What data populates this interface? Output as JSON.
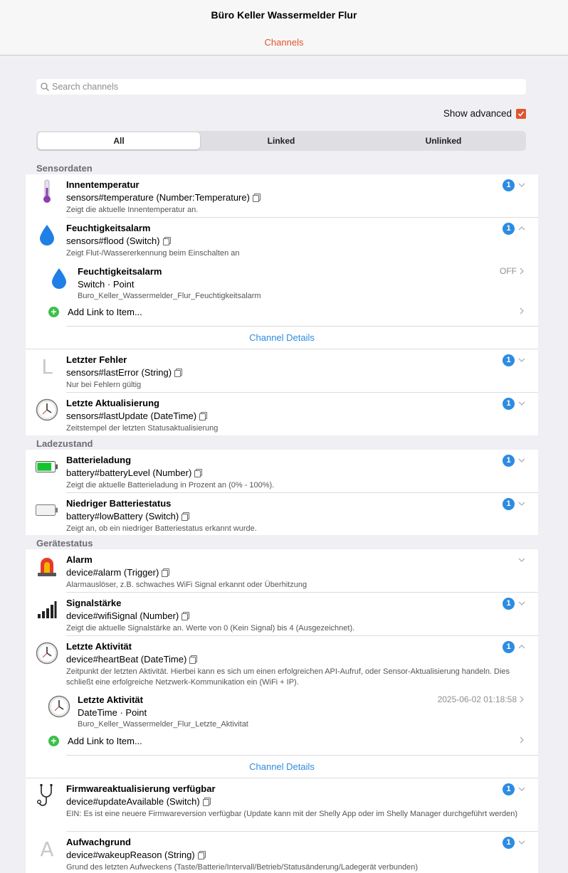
{
  "header": {
    "title": "Büro Keller Wassermelder Flur",
    "tab": "Channels"
  },
  "search": {
    "placeholder": "Search channels"
  },
  "advanced": {
    "label": "Show advanced",
    "checked": true
  },
  "filter": {
    "all": "All",
    "linked": "Linked",
    "unlinked": "Unlinked"
  },
  "groups": {
    "sensor": "Sensordaten",
    "battery": "Ladezustand",
    "device": "Gerätestatus"
  },
  "channels": {
    "temp": {
      "name": "Innentemperatur",
      "uid": "sensors#temperature (Number:Temperature)",
      "desc": "Zeigt die aktuelle Innentemperatur an.",
      "links": "1",
      "icon": "thermometer-icon"
    },
    "flood": {
      "name": "Feuchtigkeitsalarm",
      "uid": "sensors#flood (Switch)",
      "desc": "Zeigt Flut-/Wassererkennung beim Einschalten an",
      "links": "1",
      "icon": "water-drop-icon"
    },
    "error": {
      "name": "Letzter Fehler",
      "uid": "sensors#lastError (String)",
      "desc": "Nur bei Fehlern gültig",
      "links": "1",
      "icon": "text-icon",
      "glyph": "L"
    },
    "update": {
      "name": "Letzte Aktualisierung",
      "uid": "sensors#lastUpdate (DateTime)",
      "desc": "Zeitstempel der letzten Statusaktualisierung",
      "links": "1",
      "icon": "clock-icon"
    },
    "battery": {
      "name": "Batterieladung",
      "uid": "battery#batteryLevel (Number)",
      "desc": "Zeigt die aktuelle Batterieladung in Prozent an (0% - 100%).",
      "links": "1",
      "icon": "battery-full-icon"
    },
    "lowbat": {
      "name": "Niedriger Batteriestatus",
      "uid": "battery#lowBattery (Switch)",
      "desc": "Zeigt an, ob ein niedriger Batteriestatus erkannt wurde.",
      "links": "1",
      "icon": "battery-empty-icon"
    },
    "alarm": {
      "name": "Alarm",
      "uid": "device#alarm (Trigger)",
      "desc": "Alarmauslöser, z.B. schwaches WiFi Signal erkannt oder Überhitzung",
      "icon": "siren-icon"
    },
    "wifi": {
      "name": "Signalstärke",
      "uid": "device#wifiSignal (Number)",
      "desc": "Zeigt die aktuelle Signalstärke an. Werte von 0 (Kein Signal) bis 4 (Ausgezeichnet).",
      "links": "1",
      "icon": "signal-bars-icon"
    },
    "heartbeat": {
      "name": "Letzte Aktivität",
      "uid": "device#heartBeat (DateTime)",
      "desc": "Zeitpunkt der letzten Aktivität. Hierbei kann es sich um einen erfolgreichen API-Aufruf, oder Sensor-Aktualisierung handeln. Dies schließt eine erfolgreiche Netzwerk-Kommunikation ein (WiFi + IP).",
      "links": "1",
      "icon": "clock-icon"
    },
    "firmware": {
      "name": "Firmwareaktualisierung verfügbar",
      "uid": "device#updateAvailable (Switch)",
      "desc": "EIN: Es ist eine neuere Firmwareversion verfügbar (Update kann mit der Shelly App oder im Shelly Manager durchgeführt werden)",
      "links": "1",
      "icon": "stethoscope-icon"
    },
    "wakeup": {
      "name": "Aufwachgrund",
      "uid": "device#wakeupReason (String)",
      "desc": "Grund des letzten Aufweckens (Taste/Batterie/Intervall/Betrieb/Statusänderung/Ladegerät verbunden)",
      "links": "1",
      "icon": "text-icon",
      "glyph": "A"
    }
  },
  "items": {
    "flood": {
      "label": "Feuchtigkeitsalarm",
      "type": "Switch · Point",
      "name": "Buro_Keller_Wassermelder_Flur_Feuchtigkeitsalarm",
      "state": "OFF"
    },
    "heartbeat": {
      "label": "Letzte Aktivität",
      "type": "DateTime · Point",
      "name": "Buro_Keller_Wassermelder_Flur_Letzte_Aktivitat",
      "state": "2025-06-02 01:18:58"
    }
  },
  "actions": {
    "add_link": "Add Link to Item...",
    "details": "Channel Details"
  },
  "colors": {
    "accent": "#e0542c",
    "link": "#2d8ce0",
    "badge": "#2d8ce0",
    "add": "#3cc04c"
  }
}
